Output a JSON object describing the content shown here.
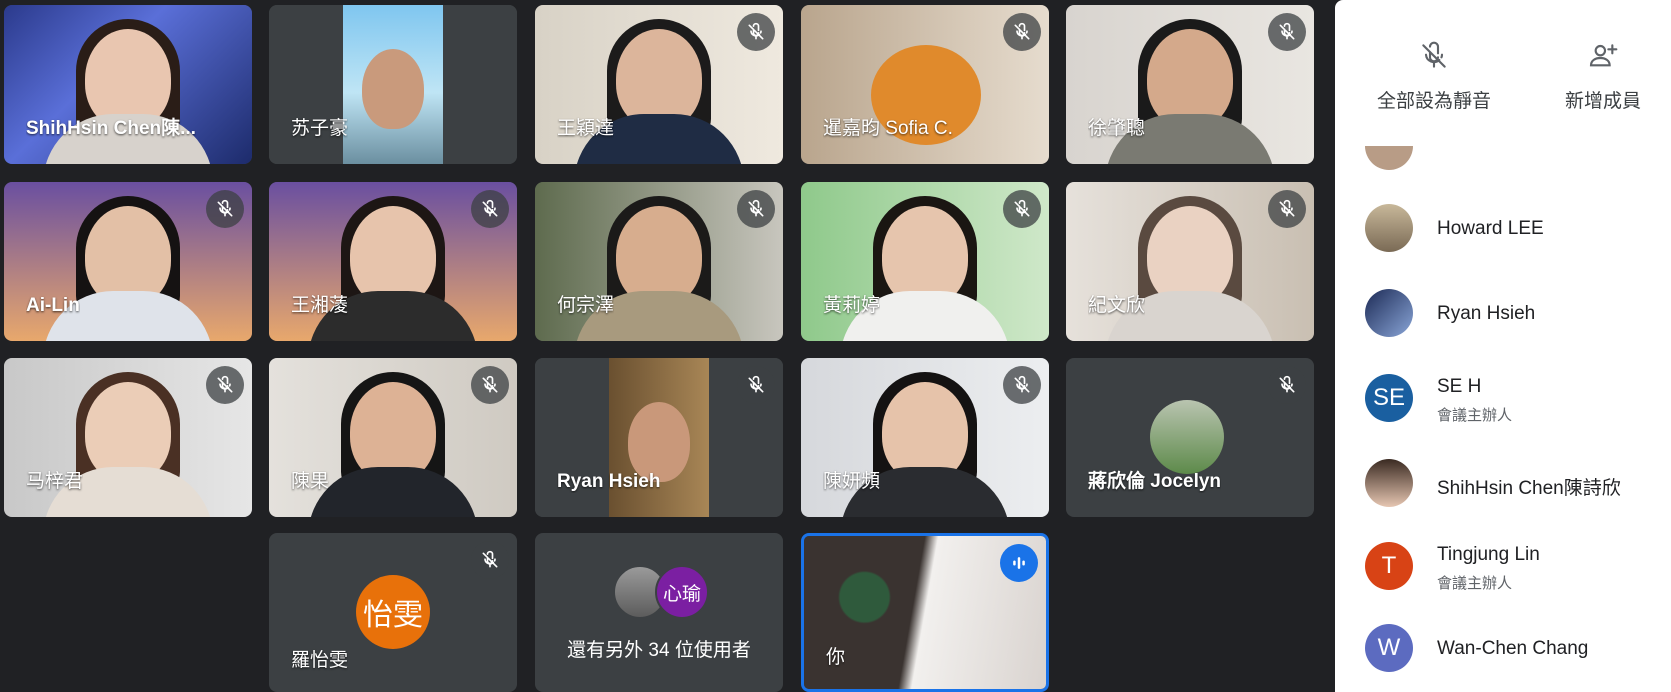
{
  "tiles": [
    {
      "name": "ShihHsin Chen陳...",
      "muted": false
    },
    {
      "name": "苏子豪",
      "muted": false
    },
    {
      "name": "王穎達",
      "muted": true
    },
    {
      "name": "暹嘉昀 Sofia C.",
      "muted": true
    },
    {
      "name": "徐肇聰",
      "muted": true
    },
    {
      "name": "Ai-Lin",
      "muted": true
    },
    {
      "name": "王湘蓤",
      "muted": true
    },
    {
      "name": "何宗澤",
      "muted": true
    },
    {
      "name": "黃莉婷",
      "muted": true
    },
    {
      "name": "紀文欣",
      "muted": true
    },
    {
      "name": "马梓君",
      "muted": true
    },
    {
      "name": "陳果",
      "muted": true
    },
    {
      "name": "Ryan Hsieh",
      "muted": true
    },
    {
      "name": "陳妍頻",
      "muted": true
    },
    {
      "name": "蔣欣倫 Jocelyn",
      "muted": true
    },
    {
      "name": "羅怡雯",
      "muted": true,
      "avatar_text": "怡雯",
      "avatar_color": "#e8710a"
    },
    {
      "name": "還有另外 34 位使用者",
      "avatar_text": "心瑜",
      "avatar_color": "#7b1fa2"
    },
    {
      "name": "你",
      "speaking": true
    }
  ],
  "panel": {
    "actions": [
      {
        "label": "全部設為靜音",
        "icon": "mic-off-icon"
      },
      {
        "label": "新增成員",
        "icon": "person-add-icon"
      }
    ],
    "people": [
      {
        "name": "Howard LEE",
        "role": "",
        "initial": "",
        "color": "#8a7f6e"
      },
      {
        "name": "Ryan Hsieh",
        "role": "",
        "initial": "",
        "color": "#5b7fb8"
      },
      {
        "name": "SE H",
        "role": "會議主辦人",
        "initial": "SE",
        "color": "#1a5fa0"
      },
      {
        "name": "ShihHsin Chen陳詩欣",
        "role": "",
        "initial": "",
        "color": "#c9a48e"
      },
      {
        "name": "Tingjung Lin",
        "role": "會議主辦人",
        "initial": "T",
        "color": "#d84315"
      },
      {
        "name": "Wan-Chen Chang",
        "role": "",
        "initial": "W",
        "color": "#5c6bc0"
      }
    ]
  },
  "colors": {
    "accent_speaking": "#1a73e8",
    "background": "#202124"
  }
}
